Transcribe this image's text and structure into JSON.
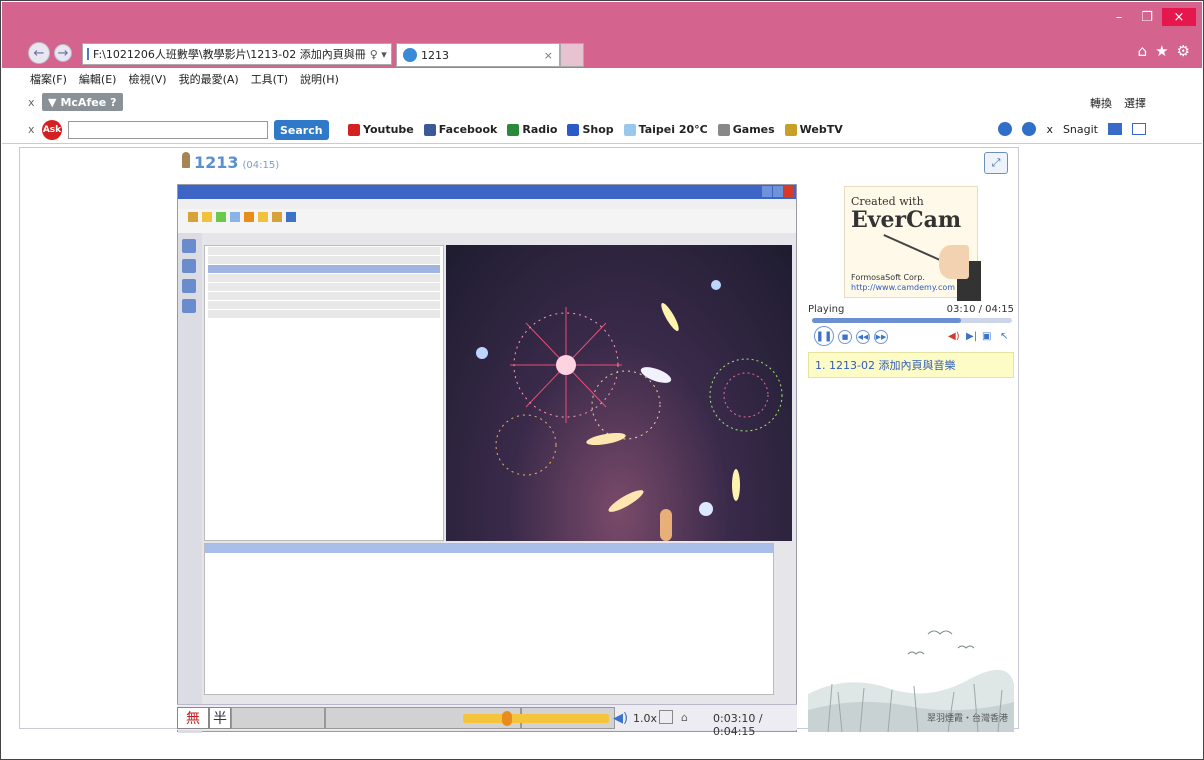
{
  "browser": {
    "address": "F:\\1021206人班數學\\教學影片\\1213-02 添加內頁與冊",
    "address_tail": "♀ ▾ C",
    "tab_title": "1213",
    "colors": {
      "titlebar": "#d4648e",
      "close": "#e5174c"
    }
  },
  "menu": [
    "檔案(F)",
    "編輯(E)",
    "檢視(V)",
    "我的最愛(A)",
    "工具(T)",
    "說明(H)"
  ],
  "mcafee": {
    "label": "McAfee",
    "right_items": [
      "轉換",
      "選擇"
    ]
  },
  "askbar": {
    "search_button": "Search",
    "links": [
      "Youtube",
      "Facebook",
      "Radio",
      "Shop",
      "Taipei 20°C",
      "Games",
      "WebTV"
    ],
    "right_items": [
      "Snagit"
    ]
  },
  "presentation": {
    "title": "1213",
    "duration": "(04:15)"
  },
  "player": {
    "speed": "1.0x",
    "time": "0:03:10 / 0:04:15",
    "progress": 0.3
  },
  "ime": {
    "char1": "無",
    "char2": "半"
  },
  "sidebar": {
    "logo_line1": "Created with",
    "logo_line2": "EverCam",
    "logo_line3": "FormosaSoft Corp.",
    "logo_line4": "http://www.camdemy.com",
    "status": "Playing",
    "time": "03:10 / 04:15",
    "progress": 0.745,
    "toc_item": "1. 1213-02 添加內頁與音樂",
    "caption": "翠羽煙霞・台灣香港"
  }
}
